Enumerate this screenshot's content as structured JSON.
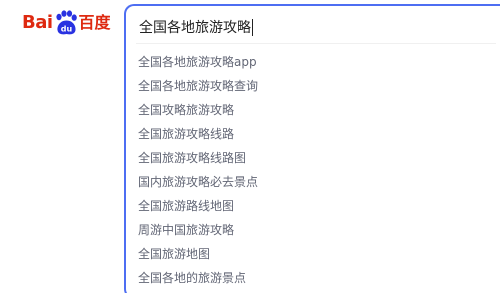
{
  "logo": {
    "left": "Bai",
    "right": "百度",
    "paw_text": "du",
    "brand_red": "#de2910",
    "brand_blue": "#2932e1"
  },
  "search": {
    "value": "全国各地旅游攻略",
    "border_color": "#4e6ef2"
  },
  "suggestions": [
    "全国各地旅游攻略app",
    "全国各地旅游攻略查询",
    "全国攻略旅游攻略",
    "全国旅游攻略线路",
    "全国旅游攻略线路图",
    "国内旅游攻略必去景点",
    "全国旅游路线地图",
    "周游中国旅游攻略",
    "全国旅游地图",
    "全国各地的旅游景点"
  ]
}
